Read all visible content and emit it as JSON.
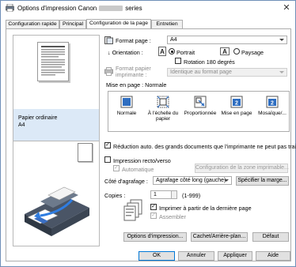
{
  "window": {
    "title_prefix": "Options d'impression Canon",
    "title_suffix": "series",
    "close_glyph": "✕"
  },
  "tabs": [
    {
      "label": "Configuration rapide",
      "active": false
    },
    {
      "label": "Principal",
      "active": false
    },
    {
      "label": "Configuration de la page",
      "active": true
    },
    {
      "label": "Entretien",
      "active": false
    }
  ],
  "preview": {
    "paper_type": "Papier ordinaire",
    "paper_size": "A4"
  },
  "page_setup": {
    "format_label": "Format page :",
    "format_value": "A4",
    "orientation_label": "Orientation :",
    "portrait_label": "Portrait",
    "landscape_label": "Paysage",
    "orientation_value": "Portrait",
    "rotate_label": "Rotation 180 degrés",
    "rotate_checked": false,
    "printer_paper_label": "Format papier imprimante :",
    "printer_paper_value": "Identique au format page",
    "layout_label": "Mise en page :",
    "layout_value": "Normale",
    "layouts": [
      {
        "label": "Normale",
        "icon": "normal-layout-icon",
        "selected": true
      },
      {
        "label": "À l'échelle du papier",
        "icon": "fit-to-page-icon",
        "selected": false
      },
      {
        "label": "Proportionnée",
        "icon": "scaled-icon",
        "selected": false
      },
      {
        "label": "Mise en page",
        "icon": "page-layout-icon",
        "selected": false
      },
      {
        "label": "Mosaïque/...",
        "icon": "tiling-icon",
        "selected": false
      }
    ],
    "reduce_label": "Réduction auto. des grands documents que l'imprimante ne peut pas traiter",
    "reduce_checked": true,
    "duplex_label": "Impression recto/verso",
    "duplex_checked": false,
    "auto_label": "Automatique",
    "auto_checked": true,
    "margin_area_button": "Configuration de la zone imprimable...",
    "stapling_label": "Côté d'agrafage :",
    "stapling_value": "Agrafage côté long (gauche)",
    "margin_button": "Spécifier la marge...",
    "copies_label": "Copies :",
    "copies_value": "1",
    "copies_range": "(1-999)",
    "last_page_label": "Imprimer à partir de la dernière page",
    "last_page_checked": true,
    "collate_label": "Assembler",
    "collate_checked": true
  },
  "buttons": {
    "print_options": "Options d'impression...",
    "stamp_background": "Cachet/Arrière-plan...",
    "defaults": "Défaut",
    "ok": "OK",
    "cancel": "Annuler",
    "apply": "Appliquer",
    "help": "Aide"
  },
  "colors": {
    "selection": "#dce9f7",
    "accent": "#0078d7",
    "window_border": "#6f8fb8"
  }
}
